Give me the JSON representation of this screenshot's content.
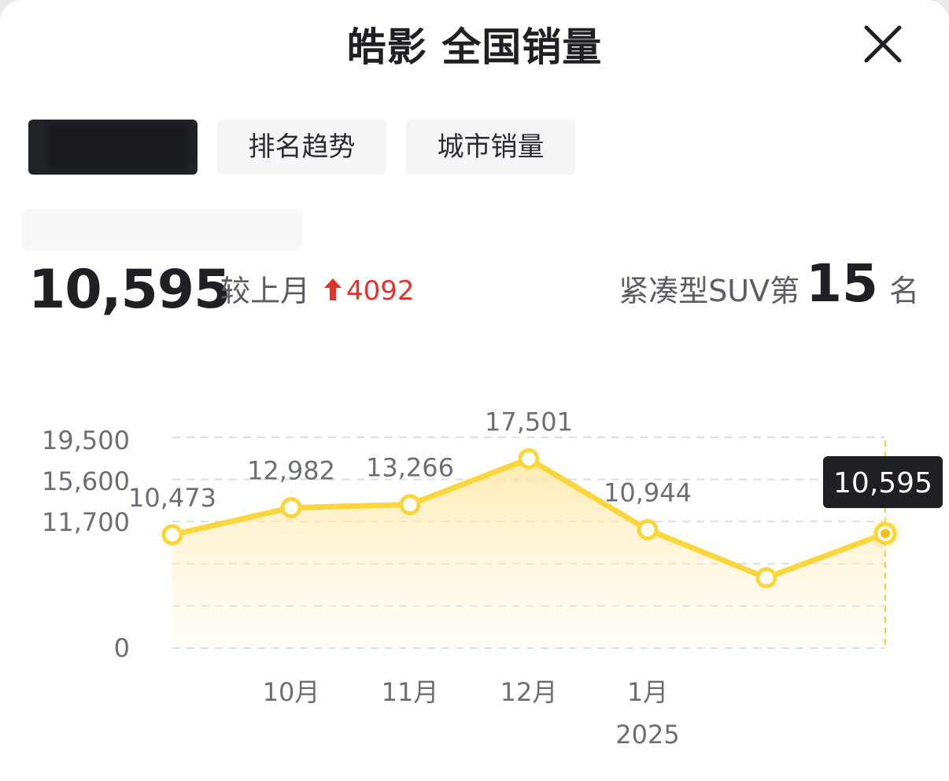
{
  "header": {
    "title": "皓影 全国销量",
    "close_icon": "close-icon"
  },
  "tabs": [
    {
      "label": "",
      "selected": true
    },
    {
      "label": "排名趋势",
      "selected": false
    },
    {
      "label": "城市销量",
      "selected": false
    }
  ],
  "summary": {
    "current_value": "10,595",
    "compare_label": "较上月",
    "compare_change": "4092",
    "compare_direction_icon": "arrow-up-icon",
    "rank_prefix": "紧凑型SUV第",
    "rank_number": "15",
    "rank_suffix": "名"
  },
  "colors": {
    "line": "#fbd63a",
    "up": "#e0342c",
    "tooltip_bg": "#1e2024",
    "selected_tab": "#1f2227"
  },
  "chart_data": {
    "type": "line",
    "categories": [
      "",
      "10月",
      "11月",
      "12月",
      "1月",
      "",
      ""
    ],
    "year_label": "2025",
    "series": [
      {
        "values": [
          10473,
          12982,
          13266,
          17501,
          10944,
          6503,
          10595
        ],
        "labels": [
          "10,473",
          "12,982",
          "13,266",
          "17,501",
          "10,944",
          "",
          ""
        ]
      }
    ],
    "y_ticks": [
      {
        "value": 19500,
        "label": "19,500"
      },
      {
        "value": 15600,
        "label": "15,600"
      },
      {
        "value": 11700,
        "label": "11,700"
      },
      {
        "value": 0,
        "label": "0"
      }
    ],
    "ylim": [
      0,
      19500
    ],
    "grid": true,
    "highlight": {
      "index": 6,
      "label": "10,595"
    }
  }
}
